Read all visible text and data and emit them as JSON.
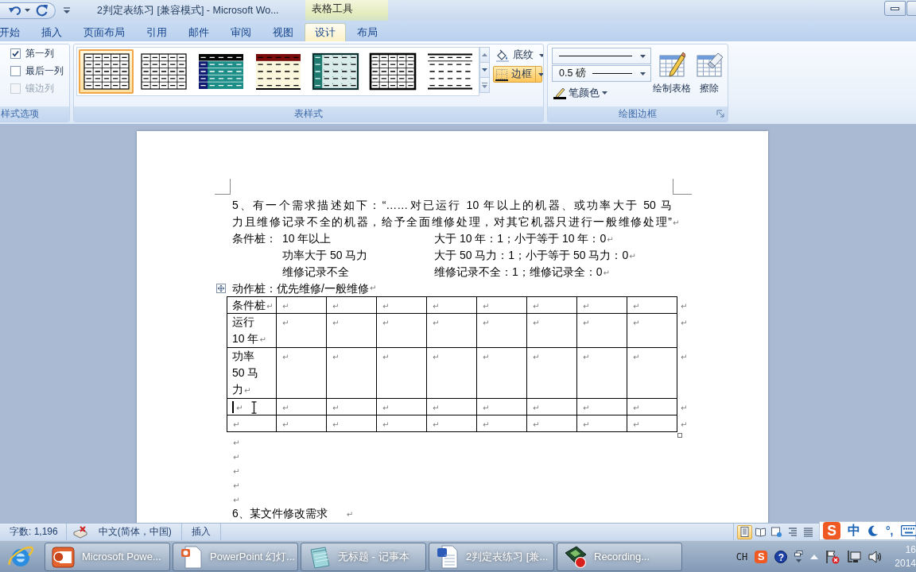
{
  "window": {
    "title": "2判定表练习 [兼容模式] - Microsoft Wo...",
    "context_tab_group": "表格工具"
  },
  "ribbon_tabs": [
    {
      "label": "开始",
      "selected": false
    },
    {
      "label": "插入",
      "selected": false
    },
    {
      "label": "页面布局",
      "selected": false
    },
    {
      "label": "引用",
      "selected": false
    },
    {
      "label": "邮件",
      "selected": false
    },
    {
      "label": "审阅",
      "selected": false
    },
    {
      "label": "视图",
      "selected": false
    },
    {
      "label": "设计",
      "selected": true
    },
    {
      "label": "布局",
      "selected": false
    }
  ],
  "style_options": {
    "label": "样式选项",
    "items": [
      {
        "label": "第一列",
        "checked": true,
        "disabled": false
      },
      {
        "label": "最后一列",
        "checked": false,
        "disabled": false
      },
      {
        "label": "镶边列",
        "checked": false,
        "disabled": true
      }
    ]
  },
  "table_styles": {
    "label": "表样式",
    "gallery": [
      {
        "kind": "grid",
        "selected": true
      },
      {
        "kind": "grid",
        "selected": false
      },
      {
        "kind": "teal-banded",
        "selected": false
      },
      {
        "kind": "red-header",
        "selected": false
      },
      {
        "kind": "teal-dotted",
        "selected": false
      },
      {
        "kind": "bold-grid",
        "selected": false
      },
      {
        "kind": "lines",
        "selected": false
      }
    ],
    "buttons": [
      {
        "kind": "shading",
        "label": "底纹",
        "highlighted": false
      },
      {
        "kind": "borders",
        "label": "边框",
        "highlighted": true
      }
    ]
  },
  "draw_borders": {
    "label": "绘图边框",
    "line_weight": "0.5 磅",
    "pen_color": "笔颜色",
    "buttons": [
      {
        "kind": "draw",
        "label": "绘制表格"
      },
      {
        "kind": "erase",
        "label": "擦除"
      }
    ]
  },
  "document": {
    "intro": {
      "lines": [
        "5、有一个需求描述如下：“……对已运行 10 年以上的机器、或功率大于 50 马",
        "力且维修记录不全的机器，给予全面维修处理，对其它机器只进行一般维修处理”"
      ],
      "mark": "↵"
    },
    "condition_stubs": {
      "label": "条件桩：",
      "rows": [
        {
          "condition": "10 年以上",
          "rule": "大于 10 年：1；小于等于 10 年：0",
          "mark": "↵"
        },
        {
          "condition": "功率大于 50 马力",
          "rule": "大于 50 马力：1；小于等于 50 马力：0",
          "mark": "↵"
        },
        {
          "condition": "维修记录不全",
          "rule": "维修记录不全：1；维修记录全：0",
          "mark": "↵"
        }
      ]
    },
    "action_stubs": {
      "text": "动作桩：优先维修/一般维修",
      "mark": "↵"
    },
    "table": {
      "rows": [
        {
          "cells": [
            {
              "lines": [
                "条件桩"
              ],
              "mark": "↵"
            },
            {
              "mark": "↵"
            },
            {
              "mark": "↵"
            },
            {
              "mark": "↵"
            },
            {
              "mark": "↵"
            },
            {
              "mark": "↵"
            },
            {
              "mark": "↵"
            },
            {
              "mark": "↵"
            },
            {
              "mark": "↵"
            }
          ],
          "end_mark": "↵"
        },
        {
          "cells": [
            {
              "lines": [
                "运行",
                "10 年"
              ],
              "mark": "↵"
            },
            {
              "mark": "↵"
            },
            {
              "mark": "↵"
            },
            {
              "mark": "↵"
            },
            {
              "mark": "↵"
            },
            {
              "mark": "↵"
            },
            {
              "mark": "↵"
            },
            {
              "mark": "↵"
            },
            {
              "mark": "↵"
            }
          ],
          "end_mark": "↵"
        },
        {
          "cells": [
            {
              "lines": [
                "功率",
                "50 马",
                "力"
              ],
              "mark": "↵"
            },
            {
              "mark": "↵"
            },
            {
              "mark": "↵"
            },
            {
              "mark": "↵"
            },
            {
              "mark": "↵"
            },
            {
              "mark": "↵"
            },
            {
              "mark": "↵"
            },
            {
              "mark": "↵"
            },
            {
              "mark": "↵"
            }
          ],
          "end_mark": "↵"
        },
        {
          "cells": [
            {
              "mark": "↵",
              "caret": true,
              "pointer": true
            },
            {
              "mark": "↵"
            },
            {
              "mark": "↵"
            },
            {
              "mark": "↵"
            },
            {
              "mark": "↵"
            },
            {
              "mark": "↵"
            },
            {
              "mark": "↵"
            },
            {
              "mark": "↵"
            },
            {
              "mark": "↵"
            }
          ],
          "end_mark": "↵"
        },
        {
          "cells": [
            {
              "mark": "↵"
            },
            {
              "mark": "↵"
            },
            {
              "mark": "↵"
            },
            {
              "mark": "↵"
            },
            {
              "mark": "↵"
            },
            {
              "mark": "↵"
            },
            {
              "mark": "↵"
            },
            {
              "mark": "↵"
            },
            {
              "mark": "↵"
            }
          ],
          "end_mark": "↵"
        }
      ]
    },
    "after_table": [
      {
        "mark": "↵"
      },
      {
        "mark": "↵"
      },
      {
        "mark": "↵"
      },
      {
        "mark": "↵"
      },
      {
        "mark": "↵"
      },
      {
        "text": "6、某文件修改需求",
        "mark": "↵"
      }
    ]
  },
  "status_bar": {
    "word_count": "字数: 1,196",
    "language": "中文(简体，中国)",
    "mode": "插入",
    "views": [
      {
        "kind": "print",
        "selected": true
      },
      {
        "kind": "reading",
        "selected": false
      },
      {
        "kind": "web",
        "selected": false
      },
      {
        "kind": "outline",
        "selected": false
      },
      {
        "kind": "draft",
        "selected": false
      }
    ]
  },
  "ime_bar": {
    "logo": "S",
    "mode": "中",
    "punctuation": "°,"
  },
  "taskbar": {
    "buttons": [
      {
        "kind": "powerpoint",
        "label": "Microsoft Powe..."
      },
      {
        "kind": "slides",
        "label": "PowerPoint 幻灯..."
      },
      {
        "kind": "notepad",
        "label": "无标题 - 记事本"
      },
      {
        "kind": "word",
        "label": "2判定表练习 [兼..."
      },
      {
        "kind": "recorder",
        "label": "Recording..."
      }
    ],
    "tray": {
      "language": "CH",
      "ime_logo": "S",
      "help": "?",
      "clock_time": "16",
      "clock_date": "2014"
    }
  }
}
